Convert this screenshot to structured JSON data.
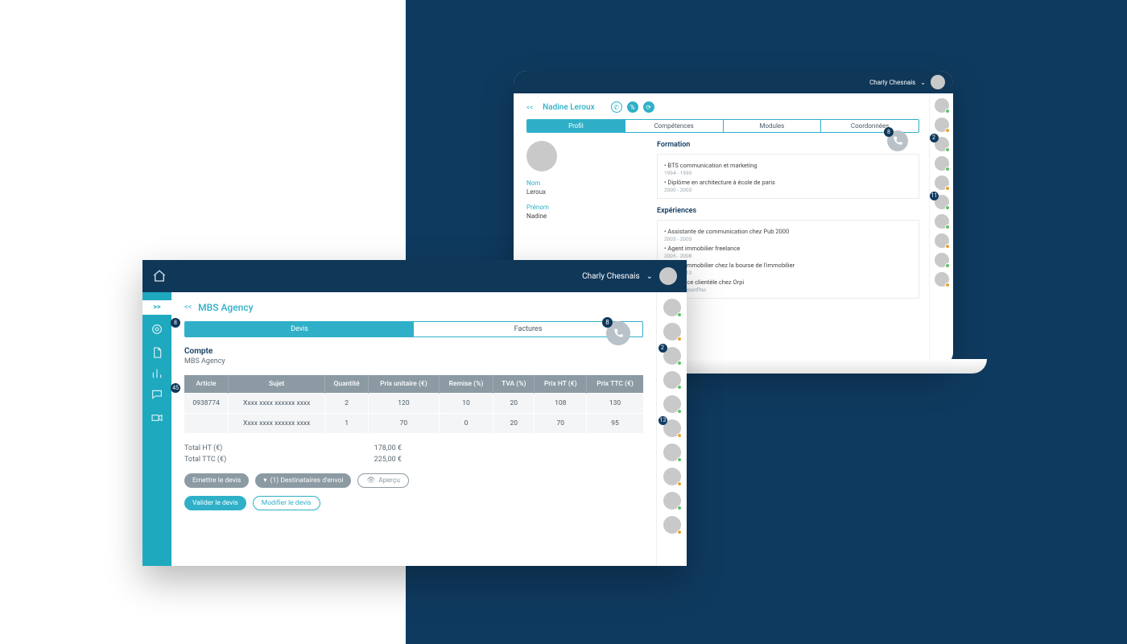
{
  "user": {
    "name": "Charly Chesnais"
  },
  "phone_badge": "8",
  "profile_window": {
    "person_name": "Nadine Leroux",
    "back": "<<",
    "tabs": [
      "Profil",
      "Compétences",
      "Modules",
      "Coordonnées"
    ],
    "active_tab": 0,
    "labels": {
      "nom": "Nom",
      "prenom": "Prénom"
    },
    "values": {
      "nom": "Leroux",
      "prenom": "Nadine"
    },
    "formation_title": "Formation",
    "formation": [
      {
        "line": "• BTS communication et marketing",
        "dates": "1994 - 1995"
      },
      {
        "line": "• Diplôme en architecture à école de paris",
        "dates": "2000 - 2003"
      }
    ],
    "experiences_title": "Expériences",
    "experiences": [
      {
        "line": "• Assistante de communication chez Pub 2000",
        "dates": "2003 - 2005"
      },
      {
        "line": "• Agent immobilier freelance",
        "dates": "2005 - 2008"
      },
      {
        "line": "• Agent immobilier chez la bourse de l'immobilier",
        "dates": "2008 - 2013"
      },
      {
        "line": "• Directrice clientèle chez Orpi",
        "dates": "2017 - Aujourd'hui"
      }
    ],
    "contact_badges": [
      "2",
      "11"
    ]
  },
  "quote_window": {
    "back": "<<",
    "title": "MBS Agency",
    "tabs": {
      "devis": "Devis",
      "factures": "Factures"
    },
    "active_tab": "devis",
    "side_expand": ">>",
    "side_badges": {
      "target": "8",
      "chat": "45"
    },
    "compte_label": "Compte",
    "compte_value": "MBS Agency",
    "columns": [
      "Article",
      "Sujet",
      "Quantité",
      "Prix unitaire (€)",
      "Remise (%)",
      "TVA (%)",
      "Prix HT (€)",
      "Prix TTC (€)"
    ],
    "rows": [
      {
        "article": "0938774",
        "sujet": "Xxxx xxxx xxxxxx xxxx",
        "qte": "2",
        "pu": "120",
        "remise": "10",
        "tva": "20",
        "ht": "108",
        "ttc": "130"
      },
      {
        "article": "",
        "sujet": "Xxxx xxxx xxxxxx xxxx",
        "qte": "1",
        "pu": "70",
        "remise": "0",
        "tva": "20",
        "ht": "70",
        "ttc": "95"
      }
    ],
    "totals": {
      "ht_label": "Total HT (€)",
      "ht": "178,00 €",
      "ttc_label": "Total TTC (€)",
      "ttc": "225,00 €"
    },
    "buttons": {
      "emettre": "Emettre le devis",
      "destinataires": "(1) Destinataires d'envoi",
      "apercu": "Aperçu",
      "valider": "Valider le devis",
      "modifier": "Modifier le devis"
    },
    "contact_badges": [
      "2",
      "13"
    ]
  }
}
